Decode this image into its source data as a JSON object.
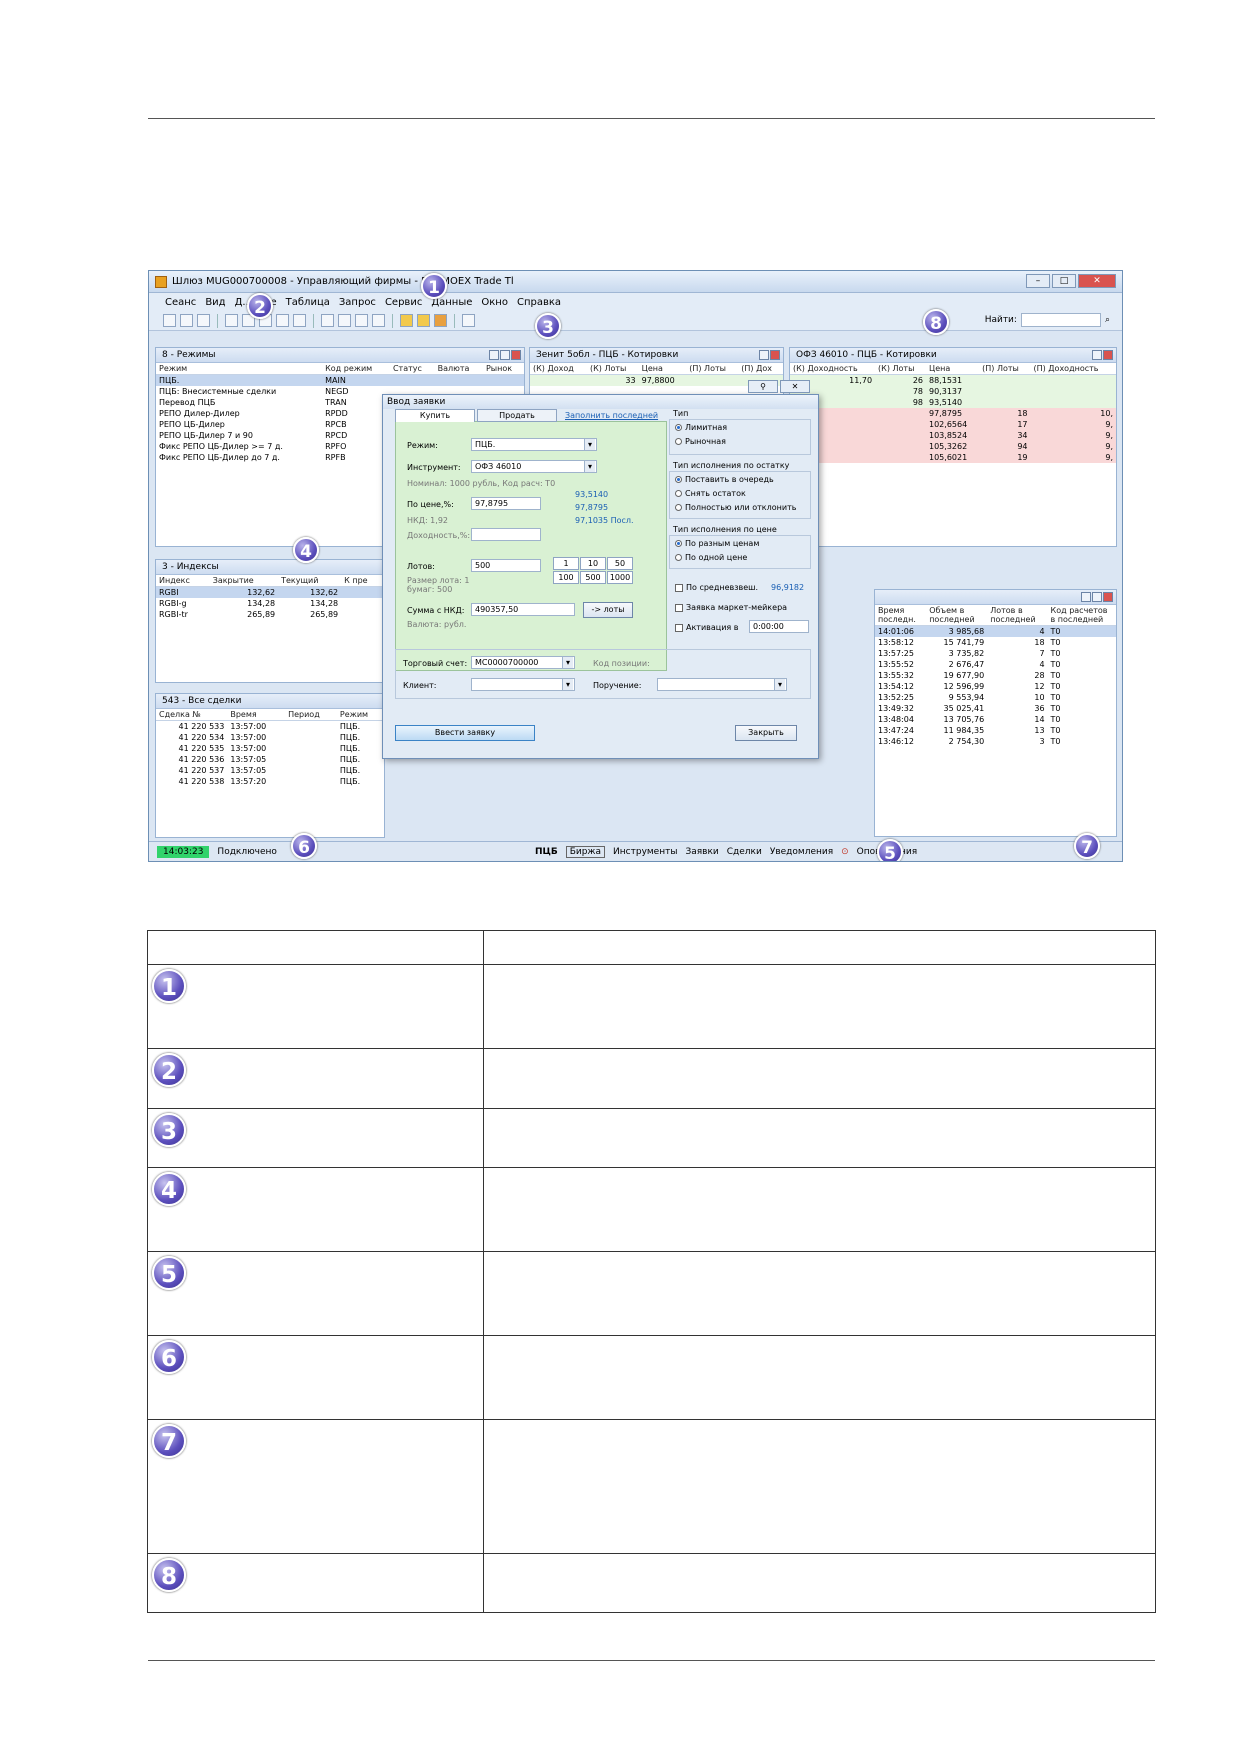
{
  "window": {
    "title": "Шлюз MUG000700008 - Управляющий фирмы - П... MOEX Trade Tl",
    "menu": [
      "Сеанс",
      "Вид",
      "Д...",
      "...е",
      "Таблица",
      "Запрос",
      "Сервис",
      "Данные",
      "Окно",
      "Справка"
    ],
    "find_label": "Найти:"
  },
  "panels": {
    "modes": {
      "title": "8 - Режимы",
      "columns": [
        "Режим",
        "Код режим",
        "Статус",
        "Валюта",
        "Рынок"
      ],
      "rows": [
        [
          "ПЦБ.",
          "MAIN"
        ],
        [
          "ПЦБ: Внесистемные сделки",
          "NEGD"
        ],
        [
          "Перевод ПЦБ",
          "TRAN"
        ],
        [
          "РЕПО Дилер-Дилер",
          "RPDD"
        ],
        [
          "РЕПО ЦБ-Дилер",
          "RPCB"
        ],
        [
          "РЕПО ЦБ-Дилер 7 и 90",
          "RPCD"
        ],
        [
          "Фикс РЕПО ЦБ-Дилер >= 7 д.",
          "RPFO"
        ],
        [
          "Фикс РЕПО ЦБ-Дилер до 7 д.",
          "RPFB"
        ]
      ]
    },
    "zenit": {
      "title": "Зенит 5обл - ПЦБ - Котировки",
      "columns": [
        "(К) Доход",
        "(К) Лоты",
        "Цена",
        "(П) Лоты",
        "(П) Дох"
      ],
      "rows": [
        [
          "",
          "33",
          "97,8800",
          "",
          ""
        ]
      ]
    },
    "ofz": {
      "title": "ОФЗ 46010 - ПЦБ - Котировки",
      "columns": [
        "(К) Доходность",
        "(К) Лоты",
        "Цена",
        "(П) Лоты",
        "(П) Доходность"
      ],
      "buy_rows": [
        [
          "11,70",
          "26",
          "88,1531"
        ],
        [
          "",
          "78",
          "90,3137"
        ],
        [
          "",
          "98",
          "93,5140"
        ]
      ],
      "sell_rows": [
        [
          "97,8795",
          "18",
          "10,"
        ],
        [
          "102,6564",
          "17",
          "9,"
        ],
        [
          "103,8524",
          "34",
          "9,"
        ],
        [
          "105,3262",
          "94",
          "9,"
        ],
        [
          "105,6021",
          "19",
          "9,"
        ]
      ]
    },
    "indexes": {
      "title": "3 - Индексы",
      "columns": [
        "Индекс",
        "Закрытие",
        "Текущий",
        "К пре"
      ],
      "rows": [
        [
          "RGBI",
          "132,62",
          "132,62"
        ],
        [
          "RGBI-g",
          "134,28",
          "134,28"
        ],
        [
          "RGBI-tr",
          "265,89",
          "265,89"
        ]
      ]
    },
    "deals": {
      "title": "543 - Все сделки",
      "columns": [
        "Сделка №",
        "Время",
        "Период",
        "Режим"
      ],
      "rows": [
        [
          "41 220 533",
          "13:57:00",
          "",
          "ПЦБ."
        ],
        [
          "41 220 534",
          "13:57:00",
          "",
          "ПЦБ."
        ],
        [
          "41 220 535",
          "13:57:00",
          "",
          "ПЦБ."
        ],
        [
          "41 220 536",
          "13:57:05",
          "",
          "ПЦБ."
        ],
        [
          "41 220 537",
          "13:57:05",
          "",
          "ПЦБ."
        ],
        [
          "41 220 538",
          "13:57:20",
          "",
          "ПЦБ."
        ]
      ]
    },
    "securities": {
      "columns": [
        "Время последн.",
        "Объем в последней",
        "Лотов в последней",
        "Код расчетов в последней"
      ],
      "rows": [
        [
          "14:01:06",
          "3 985,68",
          "4",
          "T0"
        ],
        [
          "13:58:12",
          "15 741,79",
          "18",
          "T0"
        ],
        [
          "13:57:25",
          "3 735,82",
          "7",
          "T0"
        ],
        [
          "13:55:52",
          "2 676,47",
          "4",
          "T0"
        ],
        [
          "13:55:32",
          "19 677,90",
          "28",
          "T0"
        ],
        [
          "13:54:12",
          "12 596,99",
          "12",
          "T0"
        ],
        [
          "13:52:25",
          "9 553,94",
          "10",
          "T0"
        ],
        [
          "13:49:32",
          "35 025,41",
          "36",
          "T0"
        ],
        [
          "13:48:04",
          "13 705,76",
          "14",
          "T0"
        ],
        [
          "13:47:24",
          "11 984,35",
          "13",
          "T0"
        ],
        [
          "13:46:12",
          "2 754,30",
          "3",
          "T0"
        ]
      ]
    }
  },
  "dialog": {
    "title": "Ввод заявки",
    "tab_buy": "Купить",
    "tab_sell": "Продать",
    "fill_last": "Заполнить последней",
    "mode_label": "Режим:",
    "mode_value": "ПЦБ.",
    "instrument_label": "Инструмент:",
    "instrument_value": "ОФЗ 46010",
    "nominal_note": "Номинал: 1000 рубль, Код расч: T0",
    "price_label": "По цене,%:",
    "price_value": "97,8795",
    "nkd_note": "НКД: 1,92",
    "yield_label": "Доходность,%:",
    "price_levels": [
      "93,5140",
      "97,8795",
      "97,1035 Посл."
    ],
    "lots_label": "Лотов:",
    "lots_value": "500",
    "lot_size_note": "Размер лота: 1 бумаг: 500",
    "quick_lots": [
      "1",
      "10",
      "50",
      "100",
      "500",
      "1000"
    ],
    "sum_label": "Сумма с НКД:",
    "sum_value": "490357,50",
    "to_lots": "-> лоты",
    "currency_note": "Валюта: рубл.",
    "type_title": "Тип",
    "type_limit": "Лимитная",
    "type_market": "Рыночная",
    "rest_title": "Тип исполнения по остатку",
    "rest_opts": [
      "Поставить в очередь",
      "Снять остаток",
      "Полностью или отклонить"
    ],
    "price_exec_title": "Тип исполнения по цене",
    "price_exec_opts": [
      "По разным ценам",
      "По одной цене"
    ],
    "avg_label": "По средневзвеш.",
    "avg_value": "96,9182",
    "mm_label": "Заявка маркет-мейкера",
    "activation_label": "Активация в",
    "activation_value": "0:00:00",
    "account_label": "Торговый счет:",
    "account_value": "MC0000700000",
    "position_label": "Код позиции:",
    "client_label": "Клиент:",
    "order_label": "Поручение:",
    "submit": "Ввести заявку",
    "close": "Закрыть"
  },
  "statusbar": {
    "time": "14:03:23",
    "state": "Подключено",
    "board": "ПЦБ",
    "tabs": [
      "Биржа",
      "Инструменты",
      "Заявки",
      "Сделки",
      "Уведомления",
      "Оповещения"
    ]
  },
  "legend_numbers": [
    "1",
    "2",
    "3",
    "4",
    "5",
    "6",
    "7",
    "8"
  ]
}
